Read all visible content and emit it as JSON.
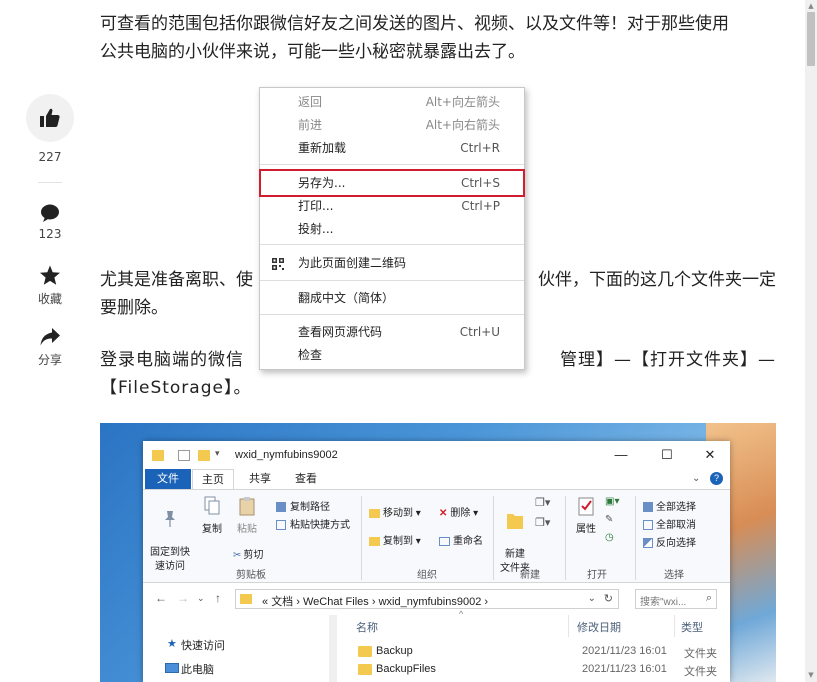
{
  "article": {
    "para1_line1": "可查看的范围包括你跟微信好友之间发送的图片、视频、以及文件等！对于那些使用",
    "para1_line2": "公共电脑的小伙伴来说，可能一些小秘密就暴露出去了。",
    "para2_line1_left": "尤其是准备离职、使",
    "para2_line1_right": "伙伴，下面的这几个文件夹一定",
    "para2_line2": "要删除。",
    "para3_line1_left": "登录电脑端的微信",
    "para3_line1_right": "管理】—【打开文件夹】—",
    "para3_line2": "【FileStorage】。"
  },
  "rail": {
    "like_count": "227",
    "comment_count": "123",
    "favorite_label": "收藏",
    "share_label": "分享"
  },
  "context_menu": {
    "items": [
      {
        "label": "返回",
        "shortcut": "Alt+向左箭头",
        "disabled": true
      },
      {
        "label": "前进",
        "shortcut": "Alt+向右箭头",
        "disabled": true
      },
      {
        "label": "重新加载",
        "shortcut": "Ctrl+R",
        "disabled": false
      },
      {
        "label": "另存为...",
        "shortcut": "Ctrl+S",
        "disabled": false,
        "highlighted": true
      },
      {
        "label": "打印...",
        "shortcut": "Ctrl+P",
        "disabled": false
      },
      {
        "label": "投射...",
        "shortcut": "",
        "disabled": false
      },
      {
        "label": "为此页面创建二维码",
        "shortcut": "",
        "disabled": false
      },
      {
        "label": "翻成中文（简体）",
        "shortcut": "",
        "disabled": false
      },
      {
        "label": "查看网页源代码",
        "shortcut": "Ctrl+U",
        "disabled": false
      },
      {
        "label": "检查",
        "shortcut": "",
        "disabled": false
      }
    ],
    "highlight_color": "#d11e2e"
  },
  "explorer": {
    "window_title": "wxid_nymfubins9002",
    "tabs": {
      "file": "文件",
      "home": "主页",
      "share": "共享",
      "view": "查看"
    },
    "ribbon": {
      "pin_quick_access": "固定到快\n速访问",
      "copy": "复制",
      "paste": "粘贴",
      "copy_path": "复制路径",
      "paste_shortcut": "粘贴快捷方式",
      "cut": "剪切",
      "clipboard_group": "剪贴板",
      "move_to": "移动到",
      "copy_to": "复制到",
      "delete": "删除",
      "rename": "重命名",
      "organize_group": "组织",
      "new_folder": "新建\n文件夹",
      "new_group": "新建",
      "properties": "属性",
      "open_group": "打开",
      "select_all": "全部选择",
      "select_none": "全部取消",
      "invert_selection": "反向选择",
      "select_group": "选择"
    },
    "address": {
      "prefix": "«",
      "path": [
        "文档",
        "WeChat Files",
        "wxid_nymfubins9002"
      ],
      "search_placeholder": "搜索\"wxi..."
    },
    "nav": {
      "quick_access": "快速访问",
      "this_pc": "此电脑"
    },
    "columns": {
      "name": "名称",
      "modified": "修改日期",
      "type": "类型"
    },
    "files": [
      {
        "name": "Backup",
        "modified": "2021/11/23 16:01",
        "type": "文件夹"
      },
      {
        "name": "BackupFiles",
        "modified": "2021/11/23 16:01",
        "type": "文件夹"
      }
    ],
    "accent_color": "#1b63b8"
  }
}
